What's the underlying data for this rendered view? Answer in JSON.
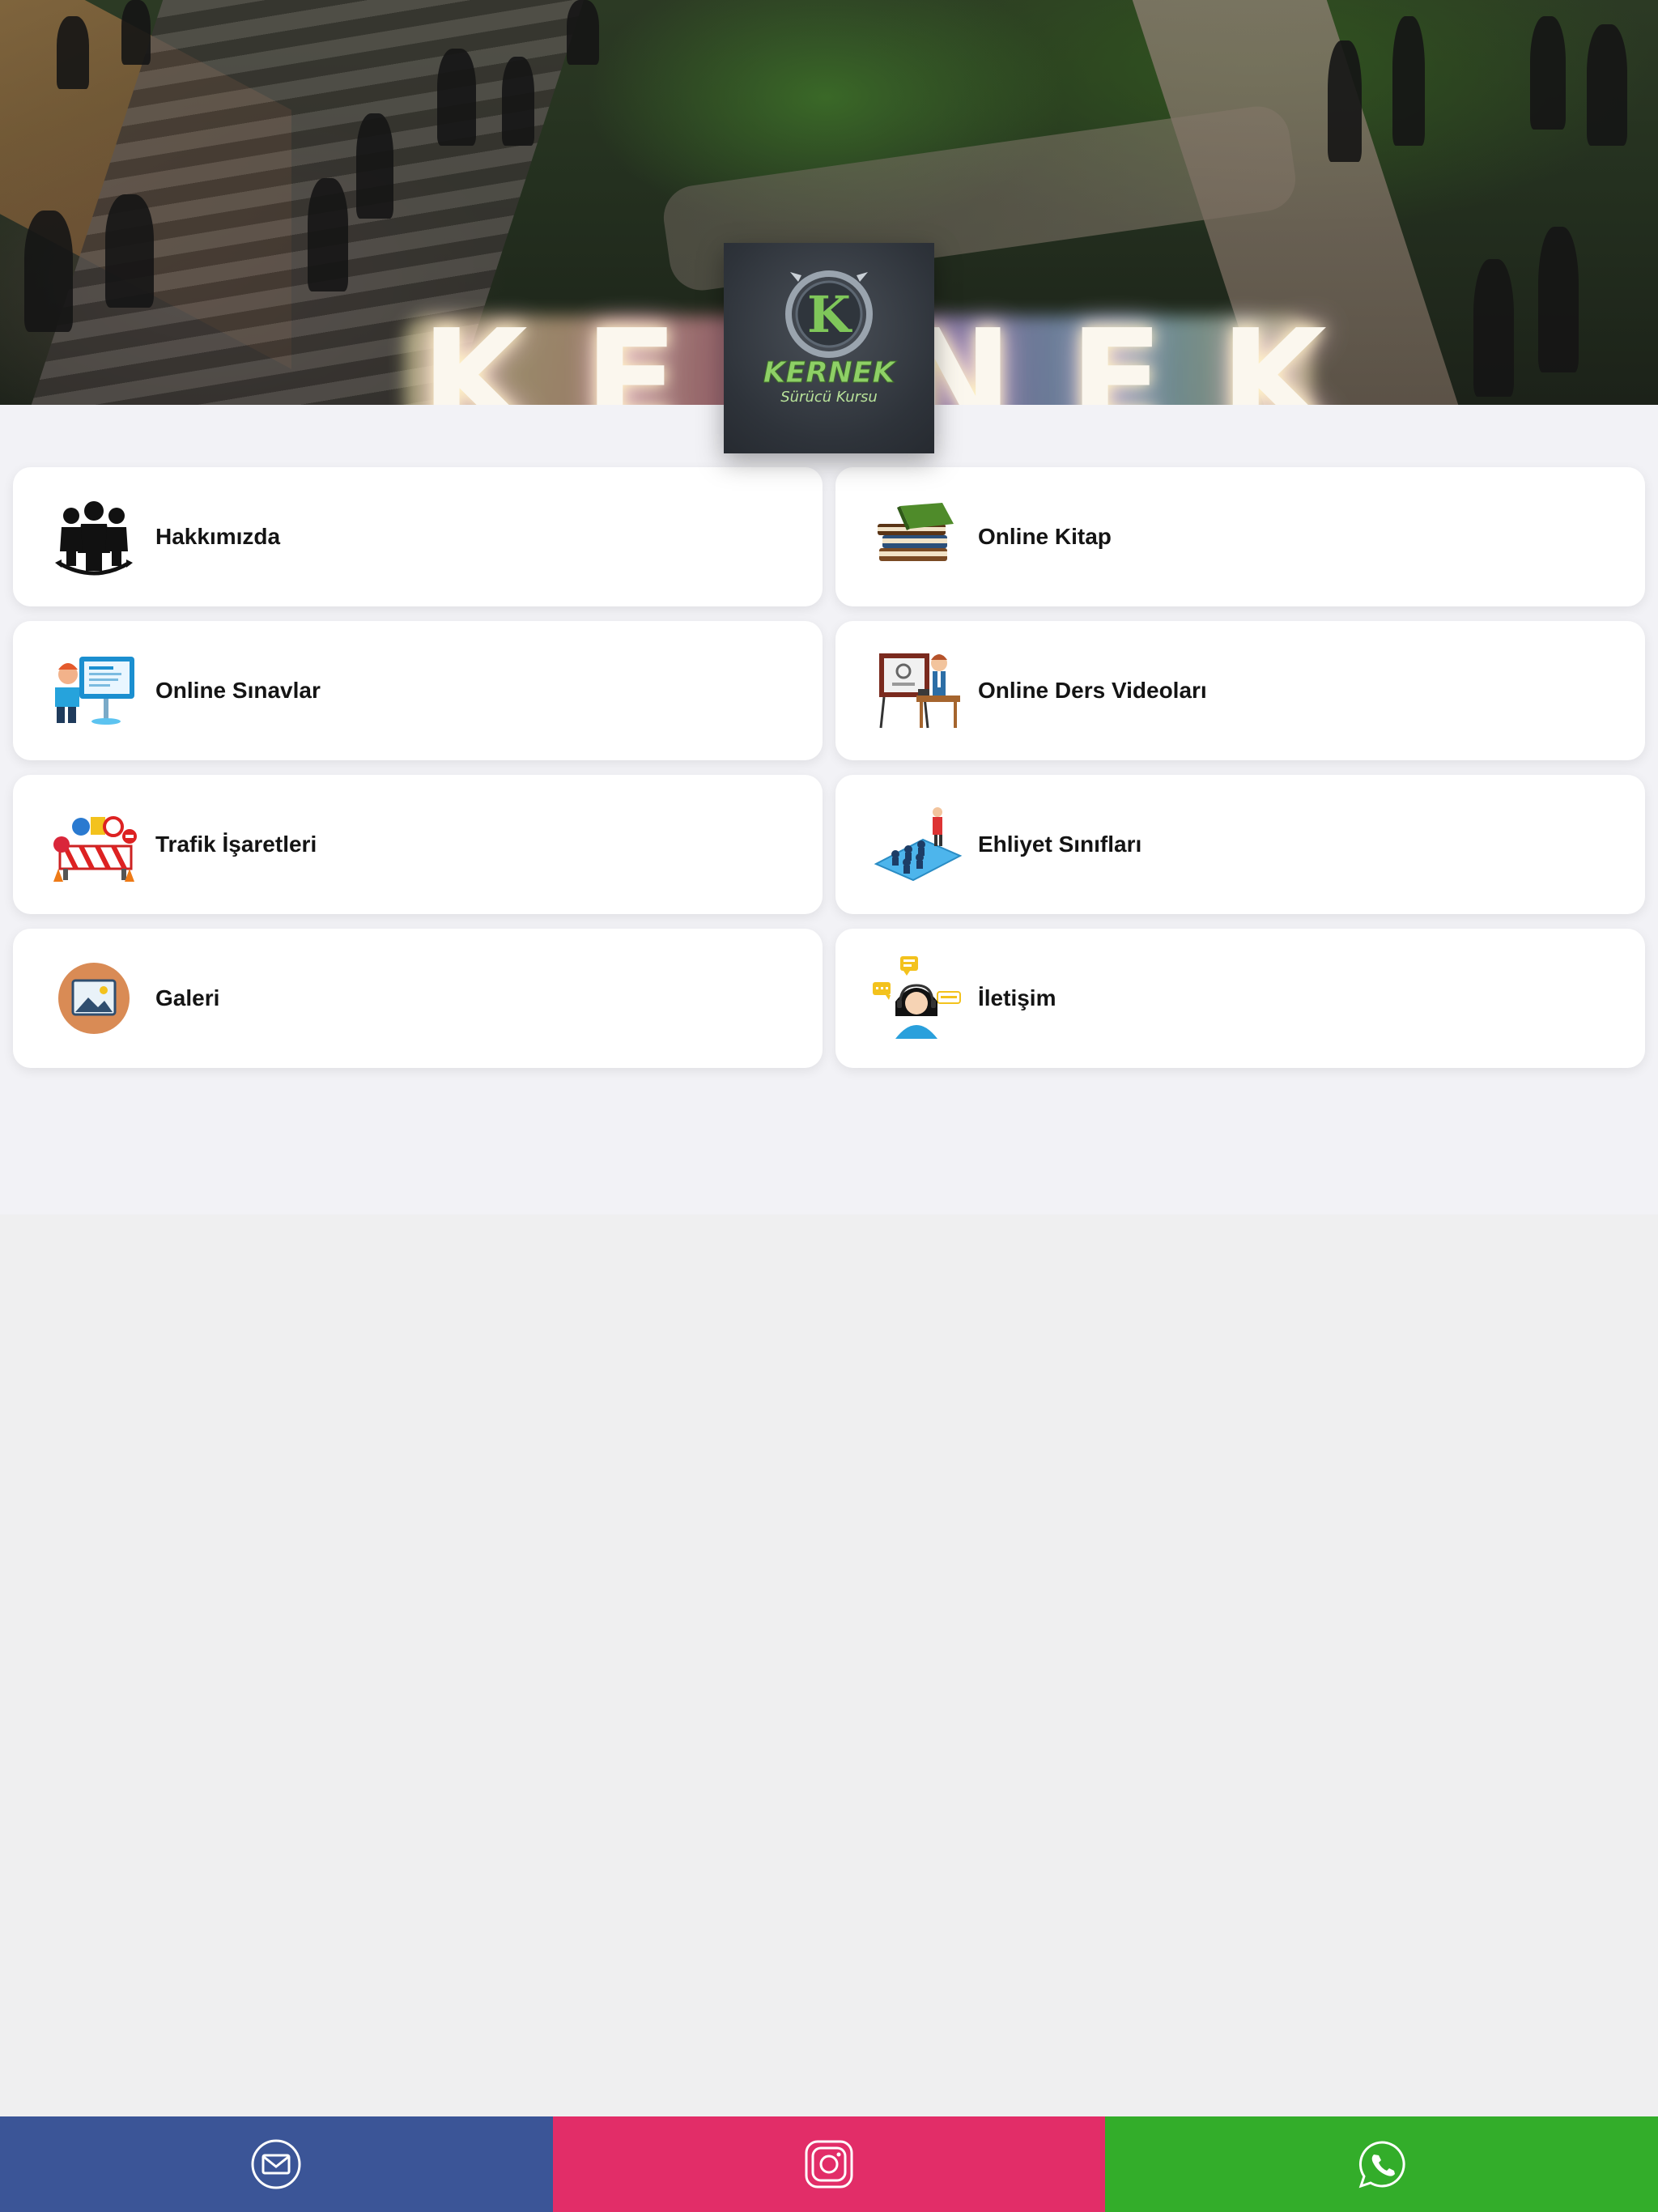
{
  "hero": {
    "sign_text": "KERNEK"
  },
  "logo": {
    "brand": "KERNEK",
    "subtitle": "Sürücü Kursu"
  },
  "menu": {
    "items": [
      {
        "label": "Hakkımızda",
        "icon": "team-icon"
      },
      {
        "label": "Online Kitap",
        "icon": "books-icon"
      },
      {
        "label": "Online Sınavlar",
        "icon": "online-exam-icon"
      },
      {
        "label": "Online Ders Videoları",
        "icon": "teacher-video-icon"
      },
      {
        "label": "Trafik İşaretleri",
        "icon": "traffic-signs-icon"
      },
      {
        "label": "Ehliyet Sınıfları",
        "icon": "classroom-icon"
      },
      {
        "label": "Galeri",
        "icon": "gallery-icon"
      },
      {
        "label": "İletişim",
        "icon": "contact-support-icon"
      }
    ]
  },
  "bottom_bar": {
    "buttons": [
      {
        "icon": "mail-icon",
        "color": "#3b5597"
      },
      {
        "icon": "instagram-icon",
        "color": "#e22d68"
      },
      {
        "icon": "whatsapp-icon",
        "color": "#33ad2a"
      }
    ]
  }
}
